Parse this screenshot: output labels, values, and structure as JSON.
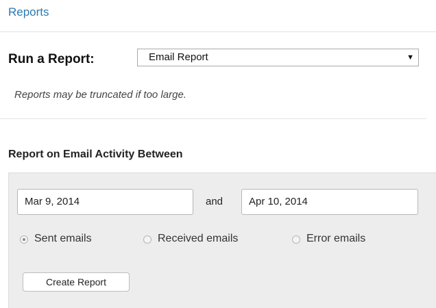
{
  "breadcrumb": {
    "label": "Reports"
  },
  "run_report": {
    "label": "Run a Report:",
    "selected": "Email Report",
    "note": "Reports may be truncated if too large."
  },
  "section": {
    "title": "Report on Email Activity Between"
  },
  "filter": {
    "start_date": "Mar 9, 2014",
    "and_label": "and",
    "end_date": "Apr 10, 2014",
    "options": [
      {
        "label": "Sent emails",
        "checked": true
      },
      {
        "label": "Received emails",
        "checked": false
      },
      {
        "label": "Error emails",
        "checked": false
      }
    ],
    "create_button": "Create Report"
  },
  "colors": {
    "link": "#2a7ab0",
    "panel_bg": "#ededed"
  },
  "icons": {
    "dropdown": "dropdown-arrow-icon"
  }
}
